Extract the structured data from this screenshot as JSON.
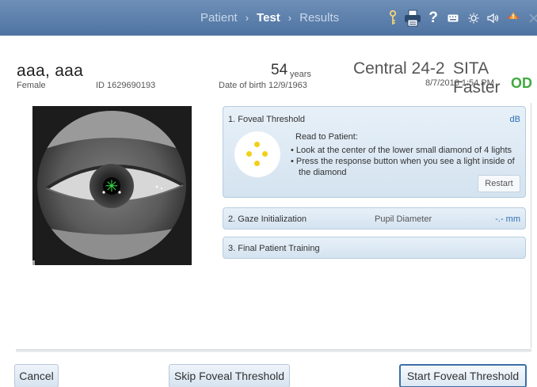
{
  "breadcrumb": {
    "step1": "Patient",
    "step2": "Test",
    "step3": "Results",
    "separator": "›"
  },
  "toolbar_icons": [
    "key-icon",
    "printer-icon",
    "help-icon",
    "keyboard-icon",
    "brightness-icon",
    "volume-icon",
    "warning-icon",
    "close-icon"
  ],
  "patient": {
    "name": "aaa, aaa",
    "gender": "Female",
    "id": "ID 1629690193",
    "age": "54",
    "age_unit": "years",
    "dob": "Date of birth  12/9/1963"
  },
  "test": {
    "name": "Central 24-2",
    "strategy": "SITA Faster",
    "datetime": "8/7/2018 1:54 PM",
    "eye": "OD",
    "eye_color": "#3faa3f"
  },
  "fixation_marker": "✳",
  "panels": {
    "foveal": {
      "title": "1. Foveal Threshold",
      "unit": "dB",
      "read_label": "Read to Patient:",
      "bullet1": "• Look at the center of the lower small diamond of 4 lights",
      "bullet2_line1": "• Press the response button when you see a light inside of",
      "bullet2_line2": "the diamond",
      "restart": "Restart",
      "diamond_color": "#f2d019"
    },
    "gaze": {
      "title": "2. Gaze Initialization",
      "pupil_label": "Pupil Diameter",
      "pupil_value": "-.- mm"
    },
    "training": {
      "title": "3. Final Patient Training"
    }
  },
  "buttons": {
    "cancel": "Cancel",
    "skip": "Skip Foveal Threshold",
    "start": "Start Foveal Threshold"
  },
  "colors": {
    "topbar": "#5a7eab",
    "accent_blue": "#2e6fb7",
    "primary_border": "#3b6fa8"
  }
}
